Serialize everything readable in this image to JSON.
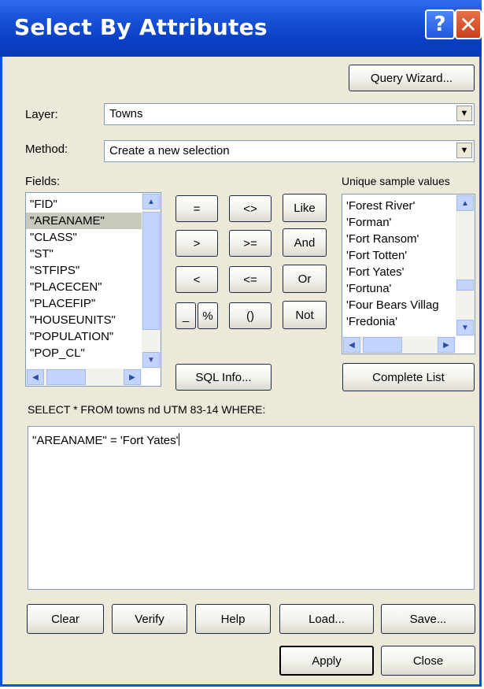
{
  "window": {
    "title": "Select By Attributes"
  },
  "toolbar": {
    "query_wizard": "Query Wizard..."
  },
  "layer": {
    "label": "Layer:",
    "value": "Towns"
  },
  "method": {
    "label": "Method:",
    "value": "Create a new selection"
  },
  "fields": {
    "label": "Fields:",
    "items": [
      "\"FID\"",
      "\"AREANAME\"",
      "\"CLASS\"",
      "\"ST\"",
      "\"STFIPS\"",
      "\"PLACECEN\"",
      "\"PLACEFIP\"",
      "\"HOUSEUNITS\"",
      "\"POPULATION\"",
      "\"POP_CL\""
    ],
    "selected_index": 1
  },
  "operators": [
    "=",
    "<>",
    "Like",
    ">",
    ">=",
    "And",
    "<",
    "<=",
    "Or",
    "_",
    "%",
    "()",
    "Not"
  ],
  "sql_info": "SQL Info...",
  "unique": {
    "label": "Unique sample values",
    "items": [
      "'Forest River'",
      "'Forman'",
      "'Fort Ransom'",
      "'Fort Totten'",
      "'Fort Yates'",
      "'Fortuna'",
      "'Four Bears Villag",
      "'Fredonia'"
    ],
    "complete_list": "Complete List"
  },
  "sql": {
    "label": "SELECT * FROM towns nd UTM 83-14 WHERE:",
    "expression": "\"AREANAME\" = 'Fort Yates'"
  },
  "buttons": {
    "clear": "Clear",
    "verify": "Verify",
    "help": "Help",
    "load": "Load...",
    "save": "Save...",
    "apply": "Apply",
    "close": "Close"
  },
  "icons": {
    "help": "?",
    "close": "✕"
  },
  "colors": {
    "titlebar": "#0a3fc4",
    "dialog_bg": "#ece9d8",
    "close_button": "#d9532c"
  }
}
